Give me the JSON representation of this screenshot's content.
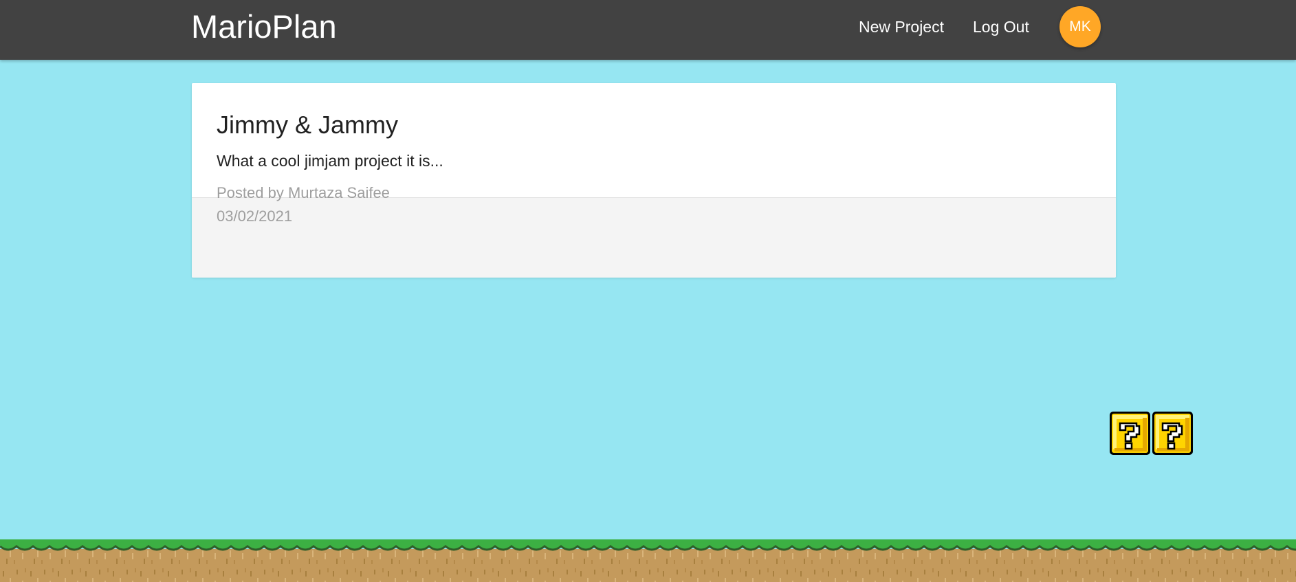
{
  "navbar": {
    "brand": "MarioPlan",
    "links": [
      {
        "label": "New Project"
      },
      {
        "label": "Log Out"
      }
    ],
    "avatar_initials": "MK",
    "avatar_color": "#ffa726",
    "background_color": "#424242"
  },
  "project": {
    "title": "Jimmy & Jammy",
    "content": "What a cool jimjam project it is...",
    "author_line": "Posted by Murtaza Saifee",
    "date": "03/02/2021"
  },
  "scene": {
    "sky_color": "#96e6f2",
    "decorations": [
      "question-block-icon",
      "question-block-icon",
      "grass-ground"
    ]
  }
}
